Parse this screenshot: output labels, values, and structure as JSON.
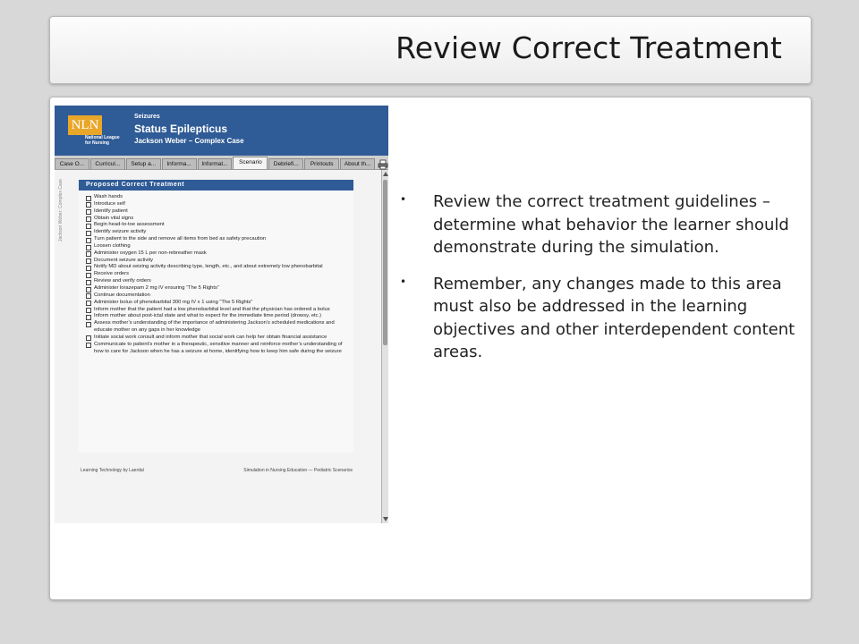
{
  "slide": {
    "title": "Review Correct Treatment",
    "bullets": [
      "Review the correct treatment guidelines – determine what behavior the learner should demonstrate during the simulation.",
      "Remember, any changes made to this area must also be addressed in the learning objectives and other interdependent content areas."
    ]
  },
  "app": {
    "logo_text": "NLN",
    "logo_subtext": "National League for Nursing",
    "case_category": "Seizures",
    "case_title": "Status Epilepticus",
    "case_subtitle": "Jackson Weber – Complex Case",
    "tabs": [
      "Case O...",
      "Curricul...",
      "Setup a...",
      "Informa...",
      "Informat...",
      "Scenario",
      "Debriefi...",
      "Printouts",
      "About th..."
    ],
    "active_tab": "Scenario",
    "doc": {
      "side_label": "Jackson Weber: Complex Case",
      "heading": "Proposed Correct Treatment",
      "items": [
        "Wash hands",
        "Introduce self",
        "Identify patient",
        "Obtain vital signs",
        "Begin head-to-toe assessment",
        "Identify seizure activity",
        "Turn patient to the side and remove all items from bed as safety precaution",
        "Loosen clothing",
        "Administer oxygen 15 L per non-rebreather mask",
        "Document seizure activity",
        "Notify MD about seizing activity describing type, length, etc., and about extremely low phenobarbital",
        "Receive orders",
        "Review and verify orders",
        "Administer lorazepam 2 mg IV ensuring “The 5 Rights”",
        "Continue documentation",
        "Administer bolus of phenobarbital 300 mg IV x 1 using “The 5 Rights”",
        "Inform mother that the patient had a low phenobarbital level and that the physician has ordered a bolus",
        "Inform mother about post-ictal state and what to expect for the immediate time period (drowsy, etc.)",
        "Assess mother’s understanding of the importance of administering Jackson’s scheduled medications and educate mother on any gaps in her knowledge",
        "Initiate social work consult and inform mother that social work can help her obtain financial assistance",
        "Communicate to patient’s mother in a therapeutic, sensitive manner and reinforce mother’s understanding of how to care for Jackson when he has a seizure at home, identifying how to keep him safe during the seizure"
      ],
      "footer_left": "Learning Technology by Laerdal",
      "footer_right": "Simulation in Nursing Education — Pediatric Scenarios"
    }
  },
  "colors": {
    "header_blue": "#2f5b96",
    "logo_gold": "#e9a72a",
    "background": "#d8d8d8"
  },
  "icons": [
    "print-icon",
    "scroll-up-arrow-icon",
    "scroll-down-arrow-icon"
  ]
}
